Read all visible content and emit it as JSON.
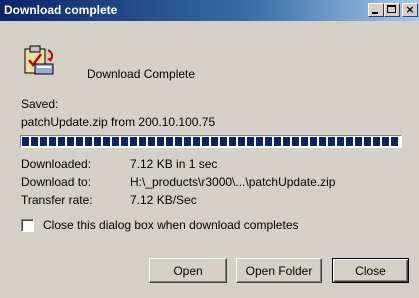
{
  "window": {
    "title": "Download complete"
  },
  "titlebar_buttons": {
    "minimize": "minimize",
    "maximize": "maximize",
    "close": "×"
  },
  "header": {
    "icon": "download-complete-icon",
    "heading": "Download Complete"
  },
  "saved": {
    "label": "Saved:",
    "filename": "patchUpdate.zip from 200.10.100.75"
  },
  "progress": {
    "fraction": 1.0
  },
  "details": [
    {
      "label": "Downloaded:",
      "value": "7.12 KB in 1 sec"
    },
    {
      "label": "Download to:",
      "value": "H:\\_products\\r3000\\...\\patchUpdate.zip"
    },
    {
      "label": "Transfer rate:",
      "value": "7.12 KB/Sec"
    }
  ],
  "options": {
    "close_when_done_label": "Close this dialog box when download completes",
    "close_when_done_checked": false
  },
  "buttons": {
    "open": "Open",
    "open_folder": "Open Folder",
    "close": "Close"
  }
}
